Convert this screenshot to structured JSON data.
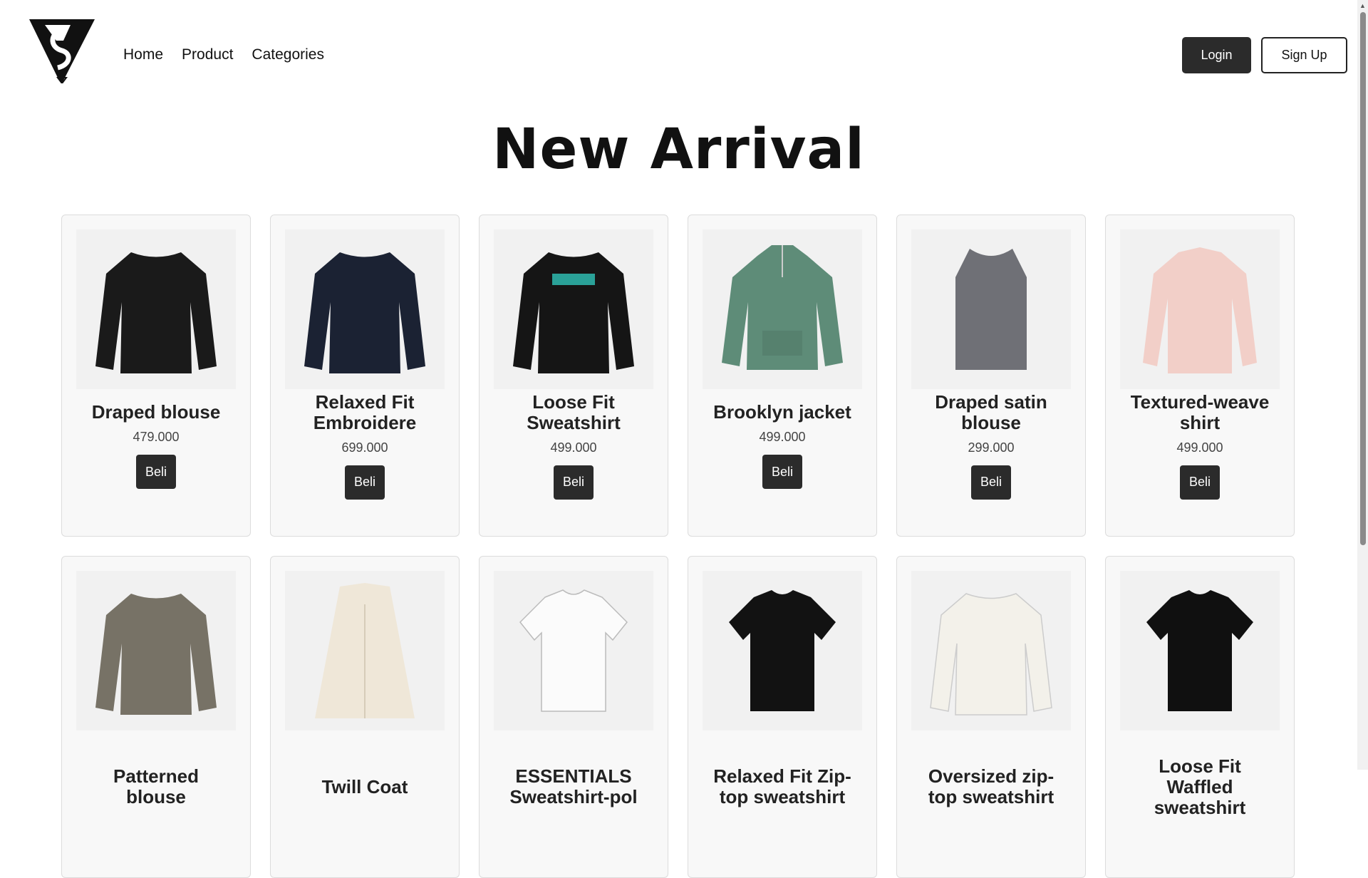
{
  "header": {
    "logo_alt": "brand logo",
    "nav": [
      "Home",
      "Product",
      "Categories"
    ],
    "login_label": "Login",
    "signup_label": "Sign Up"
  },
  "page_title": "New Arrival",
  "products": [
    {
      "name": "Draped blouse",
      "price": "479.000",
      "button": "Beli",
      "icon": "black-blouse"
    },
    {
      "name": "Relaxed Fit Embroidere",
      "price": "699.000",
      "button": "Beli",
      "icon": "navy-sweatshirt"
    },
    {
      "name": "Loose Fit Sweatshirt",
      "price": "499.000",
      "button": "Beli",
      "icon": "black-graphic-sweatshirt"
    },
    {
      "name": "Brooklyn jacket",
      "price": "499.000",
      "button": "Beli",
      "icon": "green-quarter-zip"
    },
    {
      "name": "Draped satin blouse",
      "price": "299.000",
      "button": "Beli",
      "icon": "grey-satin-top"
    },
    {
      "name": "Textured-weave shirt",
      "price": "499.000",
      "button": "Beli",
      "icon": "pink-shirt"
    },
    {
      "name": "Patterned blouse",
      "price": "",
      "button": "",
      "icon": "patterned-blouse"
    },
    {
      "name": "Twill Coat",
      "price": "",
      "button": "",
      "icon": "cream-coat"
    },
    {
      "name": "ESSENTIALS Sweatshirt-pol",
      "price": "",
      "button": "",
      "icon": "white-polo"
    },
    {
      "name": "Relaxed Fit Zip-top sweatshirt",
      "price": "",
      "button": "",
      "icon": "black-polo"
    },
    {
      "name": "Oversized zip-top sweatshirt",
      "price": "",
      "button": "",
      "icon": "cream-polo"
    },
    {
      "name": "Loose Fit Waffled sweatshirt",
      "price": "",
      "button": "",
      "icon": "black-tshirt"
    }
  ],
  "colors": {
    "button_dark": "#2b2b2b",
    "card_bg": "#f8f8f8",
    "card_border": "#dcdcdc"
  }
}
